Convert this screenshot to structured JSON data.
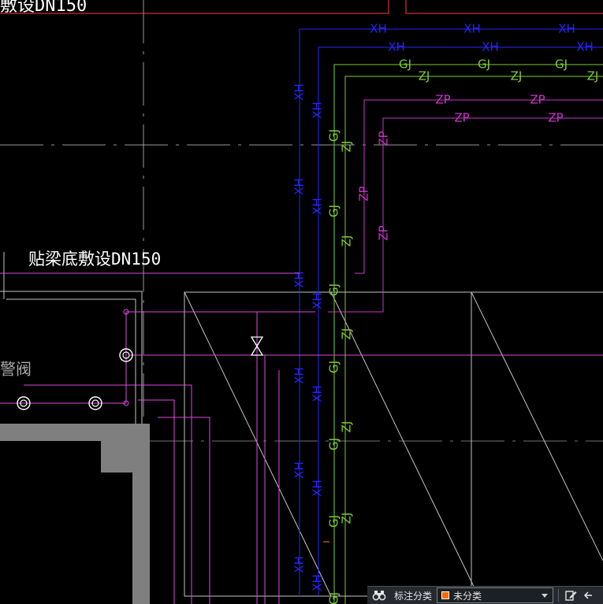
{
  "drawing": {
    "colors": {
      "background": "#000000",
      "grid": "#bdbdbd",
      "xh": "#2626ff",
      "gj": "#7fcc33",
      "zp": "#cc33cc",
      "pink": "#e048e0",
      "outline": "#c4c4c4",
      "wall": "#7f7f7f",
      "red": "#ff3b3b",
      "white": "#ffffff",
      "orange": "#ff8800"
    },
    "labels": {
      "top_note": "敷设DN150",
      "beam_note": "贴梁底敷设DN150",
      "alarm_note": "报警阀",
      "xh": "XH",
      "gj": "GJ",
      "zj": "ZJ",
      "zp": "ZP"
    }
  },
  "toolbar": {
    "first_icon": "binoculars-icon",
    "classify_label": "标注分类",
    "classify_value": "未分类",
    "swatch_color": "#ff6a00",
    "edit_icon": "edit-icon"
  }
}
